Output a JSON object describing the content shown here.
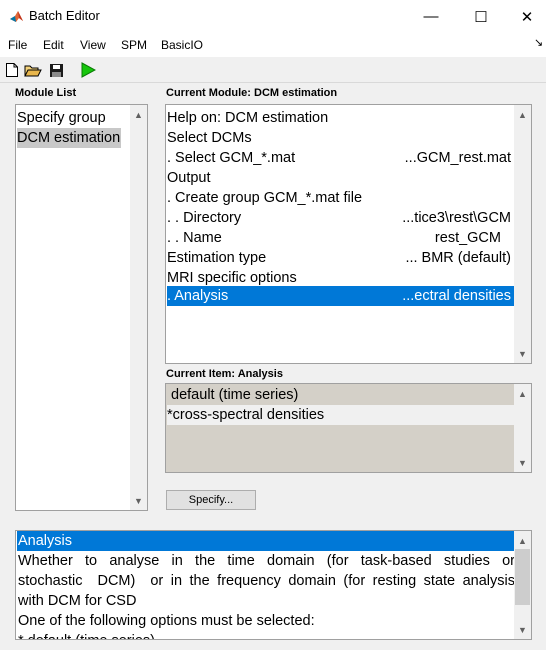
{
  "window": {
    "title": "Batch Editor",
    "icon": "matlab-icon",
    "controls": {
      "minimize": "—",
      "maximize": "☐",
      "close": "✕"
    }
  },
  "menu": {
    "items": [
      "File",
      "Edit",
      "View",
      "SPM",
      "BasicIO"
    ],
    "overflow_arrow": "↘"
  },
  "toolbar": {
    "buttons": [
      "new-file-icon",
      "open-folder-icon",
      "save-disk-icon",
      "run-play-icon"
    ]
  },
  "module_list": {
    "label": "Module List",
    "items": [
      "Specify group",
      "DCM estimation"
    ],
    "selected_index": 1
  },
  "current_module": {
    "label": "Current Module: DCM estimation",
    "rows": [
      {
        "left": "Help on: DCM estimation",
        "right": ""
      },
      {
        "left": "Select DCMs",
        "right": ""
      },
      {
        "left": " . Select GCM_*.mat",
        "right": "...GCM_rest.mat"
      },
      {
        "left": "Output",
        "right": ""
      },
      {
        "left": " . Create group GCM_*.mat file",
        "right": ""
      },
      {
        "left": " . . Directory",
        "right": "...tice3\\rest\\GCM"
      },
      {
        "left": " . . Name",
        "right": "rest_GCM"
      },
      {
        "left": "Estimation type",
        "right": "... BMR (default)"
      },
      {
        "left": "MRI specific options",
        "right": ""
      },
      {
        "left": " . Analysis",
        "right": "...ectral densities"
      }
    ],
    "selected_index": 9
  },
  "current_item": {
    "label": "Current Item: Analysis",
    "options": [
      " default (time series)",
      "*cross-spectral densities"
    ]
  },
  "specify_button": "Specify...",
  "help": {
    "title": "Analysis",
    "lines": [
      "Whether  to  analyse  in  the  time  domain  (for  task-based  studies  or",
      "stochastic  DCM)  or in the frequency domain (for resting state analysis",
      "with DCM for CSD",
      "One of the following options must be selected:",
      "* default (time series)"
    ]
  },
  "colors": {
    "selection_blue": "#0078d7",
    "module_selected_gray": "#c8c8c8",
    "item_option_bg": "#d4d0c8",
    "window_bg": "#f0f0f0",
    "play_green": "#16c60c"
  }
}
